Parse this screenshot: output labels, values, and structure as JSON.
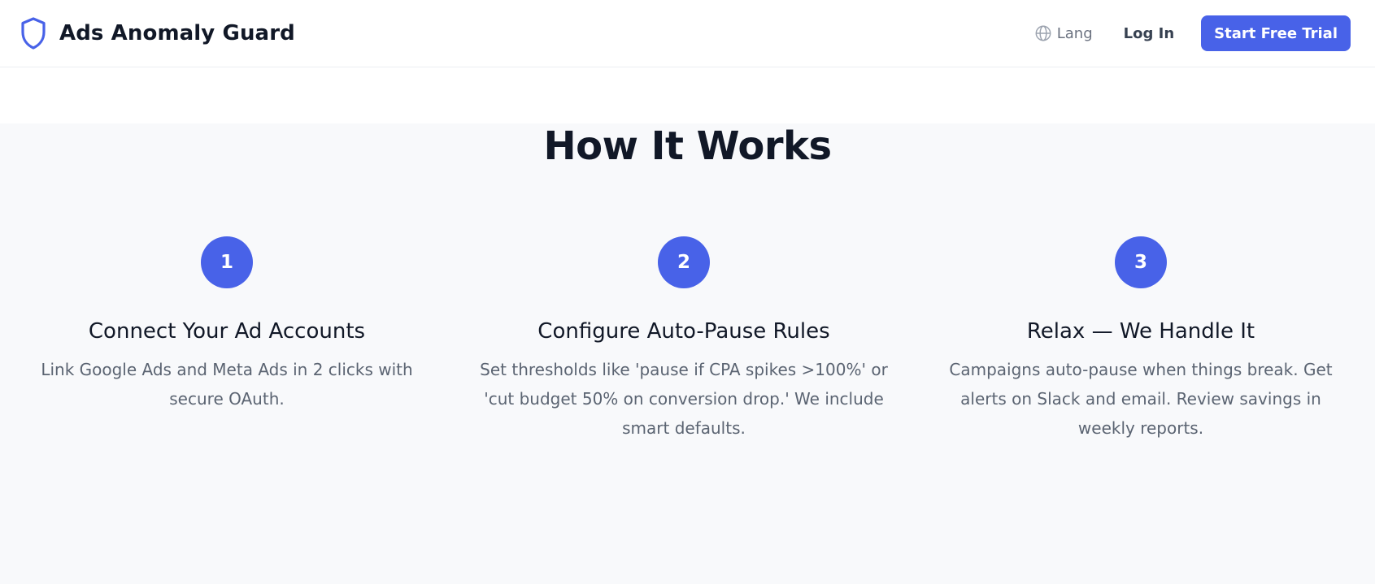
{
  "header": {
    "brand_name": "Ads Anomaly Guard",
    "brand_icon": "shield-icon",
    "lang_label": "Lang",
    "lang_icon": "globe-icon",
    "login_label": "Log In",
    "cta_label": "Start Free Trial"
  },
  "how_it_works": {
    "title": "How It Works",
    "steps": [
      {
        "number": "1",
        "title": "Connect Your Ad Accounts",
        "description": "Link Google Ads and Meta Ads in 2 clicks with secure OAuth."
      },
      {
        "number": "2",
        "title": "Configure Auto-Pause Rules",
        "description": "Set thresholds like 'pause if CPA spikes >100%' or 'cut budget 50% on conversion drop.' We include smart defaults."
      },
      {
        "number": "3",
        "title": "Relax — We Handle It",
        "description": "Campaigns auto-pause when things break. Get alerts on Slack and email. Review savings in weekly reports."
      }
    ]
  },
  "colors": {
    "accent": "#4862e8",
    "section_bg": "#f8f9fb",
    "heading": "#111827",
    "muted": "#5b6472"
  }
}
